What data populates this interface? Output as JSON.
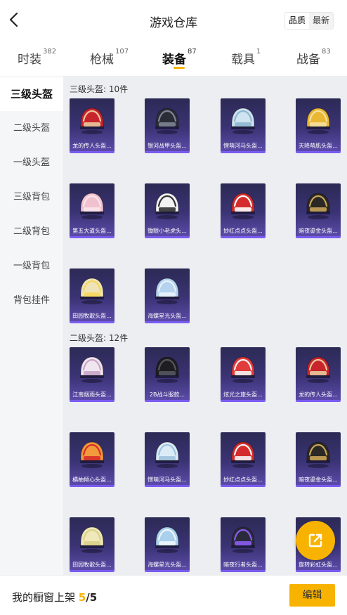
{
  "header": {
    "title": "游戏仓库",
    "sort_options": [
      "品质",
      "最新"
    ],
    "sort_active": "品质"
  },
  "tabs": [
    {
      "label": "时装",
      "count": "382",
      "active": false
    },
    {
      "label": "枪械",
      "count": "107",
      "active": false
    },
    {
      "label": "装备",
      "count": "87",
      "active": true
    },
    {
      "label": "载具",
      "count": "1",
      "active": false
    },
    {
      "label": "战备",
      "count": "83",
      "active": false
    }
  ],
  "sidebar": [
    {
      "label": "三级头盔",
      "active": true
    },
    {
      "label": "二级头盔",
      "active": false
    },
    {
      "label": "一级头盔",
      "active": false
    },
    {
      "label": "三级背包",
      "active": false
    },
    {
      "label": "二级背包",
      "active": false
    },
    {
      "label": "一级背包",
      "active": false
    },
    {
      "label": "背包挂件",
      "active": false
    }
  ],
  "sections": [
    {
      "title": "三级头盔: 10件",
      "items": [
        {
          "name": "龙的传人头盔...",
          "color": "#c8242b",
          "accent": "#e9c9a0"
        },
        {
          "name": "银河战甲头盔...",
          "color": "#2a2d36",
          "accent": "#7e8594"
        },
        {
          "name": "憎萌河马头盔...",
          "color": "#cfe3f0",
          "accent": "#8fb6d0"
        },
        {
          "name": "天降萌肌头盔...",
          "color": "#e8b733",
          "accent": "#f6e0a0"
        },
        {
          "name": "第五大道头盔...",
          "color": "#f2c1cf",
          "accent": "#fbe6ec"
        },
        {
          "name": "锄眼小老虎头...",
          "color": "#f3f3f3",
          "accent": "#333333"
        },
        {
          "name": "妙红点点头盔...",
          "color": "#d42c2c",
          "accent": "#ffffff"
        },
        {
          "name": "暗夜鎏金头盔...",
          "color": "#2b2925",
          "accent": "#c9a45a"
        },
        {
          "name": "田园牧歌头盔...",
          "color": "#efe4b8",
          "accent": "#f6d75b"
        },
        {
          "name": "海螺星光头盔...",
          "color": "#b5d2ee",
          "accent": "#e9f3fb"
        }
      ]
    },
    {
      "title": "二级头盔: 12件",
      "items": [
        {
          "name": "江南烟雨头盔...",
          "color": "#f0e6ef",
          "accent": "#c9a4c6"
        },
        {
          "name": "2B战斗服款...",
          "color": "#1e1e22",
          "accent": "#55565e"
        },
        {
          "name": "炫光之旅头盔...",
          "color": "#e23b3b",
          "accent": "#f4f4f4"
        },
        {
          "name": "龙的传人头盔...",
          "color": "#c8242b",
          "accent": "#e9c9a0"
        },
        {
          "name": "橘柚倾心头盔...",
          "color": "#f19a3b",
          "accent": "#d92c2c"
        },
        {
          "name": "憎萌河马头盔...",
          "color": "#dcecf7",
          "accent": "#9fc3dc"
        },
        {
          "name": "妙红点点头盔...",
          "color": "#d42c2c",
          "accent": "#f5f5f5"
        },
        {
          "name": "暗夜鎏金头盔...",
          "color": "#2b2925",
          "accent": "#c9a45a"
        },
        {
          "name": "田园牧歌头盔...",
          "color": "#efe8b8",
          "accent": "#dcd08a"
        },
        {
          "name": "海螺星光头盔...",
          "color": "#a9d0ec",
          "accent": "#eef6fc"
        },
        {
          "name": "暗夜行者头盔...",
          "color": "#2a2b3a",
          "accent": "#8c5cf5"
        },
        {
          "name": "旋转彩虹头盔...",
          "color": "#3a3a40",
          "accent": "#d6d6d6"
        }
      ]
    }
  ],
  "footer": {
    "text": "我的橱窗上架",
    "count": "5",
    "total": "/5",
    "edit_label": "编辑"
  }
}
